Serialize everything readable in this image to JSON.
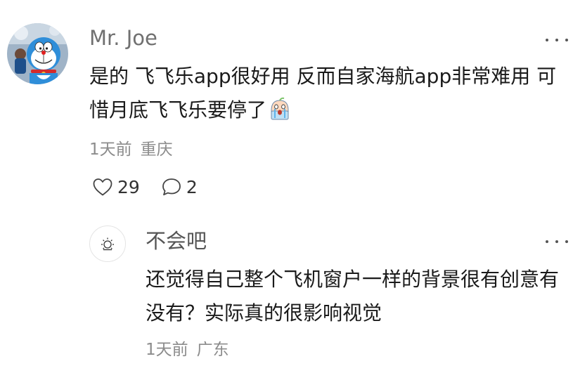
{
  "comment": {
    "author": "Mr. Joe",
    "text": "是的 飞飞乐app很好用 反而自家海航app非常难用 可惜月底飞飞乐要停了",
    "emoji_icon": "face-with-tears-emoji",
    "time": "1天前",
    "location": "重庆",
    "likes": "29",
    "replies": "2",
    "avatar_icon": "doraemon-avatar",
    "more_icon": "more-dots-icon"
  },
  "reply": {
    "author": "不会吧",
    "text": "还觉得自己整个飞机窗户一样的背景很有创意有没有？实际真的很影响视觉",
    "time": "1天前",
    "location": "广东",
    "avatar_icon": "sun-avatar-icon"
  },
  "colors": {
    "author_gray": "#707070",
    "meta_gray": "#8c8c8c",
    "text": "#1a1a1a",
    "avatar_blue": "#2f8ed9"
  }
}
